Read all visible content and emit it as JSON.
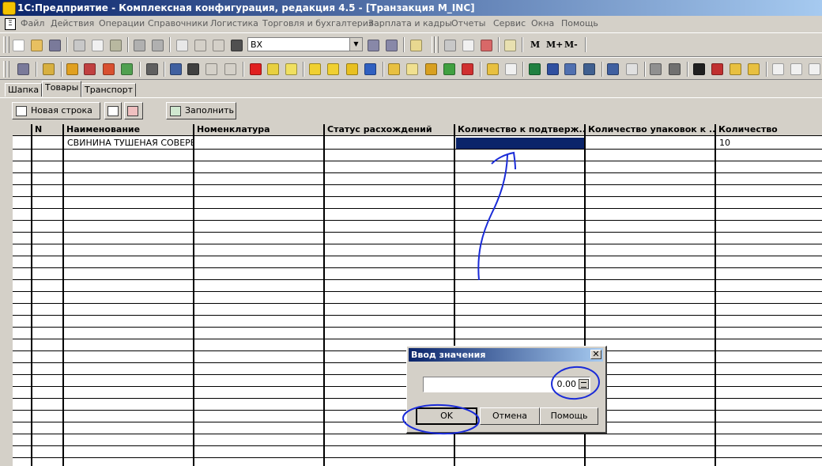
{
  "window": {
    "title": "1С:Предприятие - Комплексная конфигурация, редакция 4.5 - [Транзакция M_INC]"
  },
  "menu": {
    "doc_icon": "Ξ",
    "items": [
      "Файл",
      "Действия",
      "Операции",
      "Справочники",
      "Логистика",
      "Торговля и бухгалтерия",
      "Зарплата и кадры",
      "Отчеты",
      "Сервис",
      "Окна",
      "Помощь"
    ]
  },
  "toolbar": {
    "search_value": "BX",
    "m_label": "M",
    "mplus_label": "M+",
    "mminus_label": "M-"
  },
  "tabs": [
    "Шапка",
    "Товары",
    "Транспорт"
  ],
  "actions": {
    "new_row": "Новая строка",
    "fill": "Заполнить"
  },
  "table": {
    "headers": [
      "N",
      "Наименование",
      "Номенклатура",
      "Статус расхождений",
      "Количество к подтверж...",
      "Количество упаковок к ...",
      "Количество"
    ],
    "rows": [
      {
        "name": "СВИНИНА ТУШЕНАЯ СОВЕРЕНОВ",
        "quantity": "10"
      }
    ]
  },
  "dialog": {
    "title": "Ввод значения",
    "close_glyph": "✕",
    "value": "0.00",
    "ok": "OK",
    "cancel": "Отмена",
    "help": "Помощь"
  },
  "colors": {
    "title_gradient_start": "#0a246a",
    "selection": "#0a246a",
    "annotation": "#1a2bd8"
  }
}
